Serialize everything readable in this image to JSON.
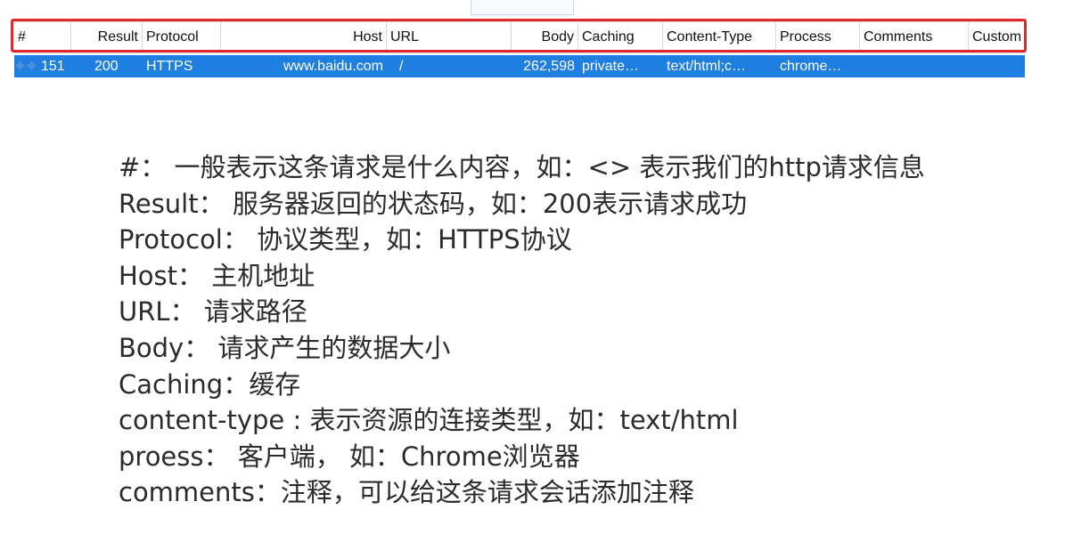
{
  "grid": {
    "columns": [
      "#",
      "Result",
      "Protocol",
      "Host",
      "URL",
      "Body",
      "Caching",
      "Content-Type",
      "Process",
      "Comments",
      "Custom"
    ],
    "selected_row": {
      "icon": "request-arrows-icon",
      "cells": [
        "151",
        "200",
        "HTTPS",
        "www.baidu.com",
        "/",
        "262,598",
        "private…",
        "text/html;c…",
        "chrome…",
        "",
        ""
      ]
    },
    "colors": {
      "selected_row_bg": "#1e7fe0",
      "highlight_frame": "#e2272b"
    }
  },
  "notes": [
    "#：  一般表示这条请求是什么内容，如：<> 表示我们的http请求信息",
    "Result： 服务器返回的状态码，如：200表示请求成功",
    "Protocol： 协议类型，如：HTTPS协议",
    "Host： 主机地址",
    "URL：  请求路径",
    "Body： 请求产生的数据大小",
    "Caching：缓存",
    "content-type : 表示资源的连接类型，如：text/html",
    "proess： 客户端，  如：Chrome浏览器",
    "comments：注释，可以给这条请求会话添加注释"
  ]
}
